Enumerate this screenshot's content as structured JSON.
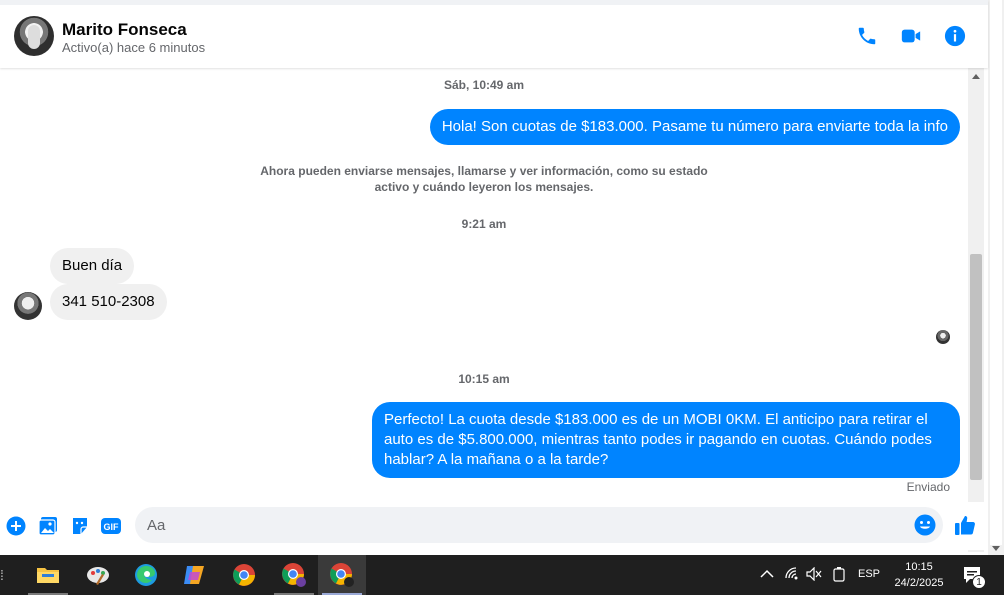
{
  "header": {
    "name": "Marito Fonseca",
    "status": "Activo(a) hace 6 minutos",
    "accent": "#0084ff"
  },
  "chat": {
    "timestamps": [
      "Sáb, 10:49 am",
      "9:21 am",
      "10:15 am"
    ],
    "system_notice": "Ahora pueden enviarse mensajes, llamarse y ver información, como su estado activo y cuándo leyeron los mensajes.",
    "messages": [
      {
        "from": "me",
        "text": "Hola! Son cuotas de $183.000. Pasame tu número para enviarte toda la info"
      },
      {
        "from": "them",
        "text": "Buen día"
      },
      {
        "from": "them",
        "text": "341 510-2308"
      },
      {
        "from": "me",
        "text": "Perfecto! La cuota desde $183.000 es de un MOBI 0KM. El anticipo para retirar el auto es de $5.800.000, mientras tanto podes ir pagando en cuotas. Cuándo podes hablar? A la mañana o a la tarde?"
      }
    ],
    "delivery_status": "Enviado"
  },
  "composer": {
    "placeholder": "Aa"
  },
  "taskbar": {
    "apps": [
      "file-explorer",
      "paint",
      "edge",
      "copilot",
      "chrome",
      "chrome-profile",
      "chrome-active"
    ],
    "language": "ESP",
    "time": "10:15",
    "date": "24/2/2025",
    "notification_count": "1"
  }
}
